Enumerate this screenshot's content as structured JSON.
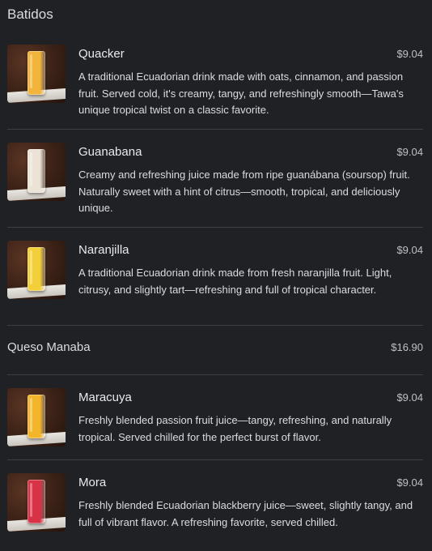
{
  "section": {
    "title": "Batidos"
  },
  "items": [
    {
      "name": "Quacker",
      "price": "$9.04",
      "description": "A traditional Ecuadorian drink made with oats, cinnamon, and passion fruit. Served cold, it's creamy, tangy, and refreshingly smooth—Tawa's unique tropical twist on a classic favorite.",
      "drink_color": "#f2b43a"
    },
    {
      "name": "Guanabana",
      "price": "$9.04",
      "description": "Creamy and refreshing juice made from ripe guanábana (soursop) fruit. Naturally sweet with a hint of citrus—smooth, tropical, and deliciously unique.",
      "drink_color": "#ece3d6"
    },
    {
      "name": "Naranjilla",
      "price": "$9.04",
      "description": "A traditional Ecuadorian drink made from fresh naranjilla fruit. Light, citrusy, and slightly tart—refreshing and full of tropical character.",
      "drink_color": "#f3cf3a"
    },
    {
      "name": "Maracuya",
      "price": "$9.04",
      "description": "Freshly blended passion fruit juice—tangy, refreshing, and naturally tropical. Served chilled for the perfect burst of flavor.",
      "drink_color": "#f3b52a"
    },
    {
      "name": "Mora",
      "price": "$9.04",
      "description": "Freshly blended Ecuadorian blackberry juice—sweet, slightly tangy, and full of vibrant flavor. A refreshing favorite, served chilled.",
      "drink_color": "#d83247"
    }
  ],
  "combo": {
    "name": "Queso Manaba",
    "price": "$16.90"
  }
}
